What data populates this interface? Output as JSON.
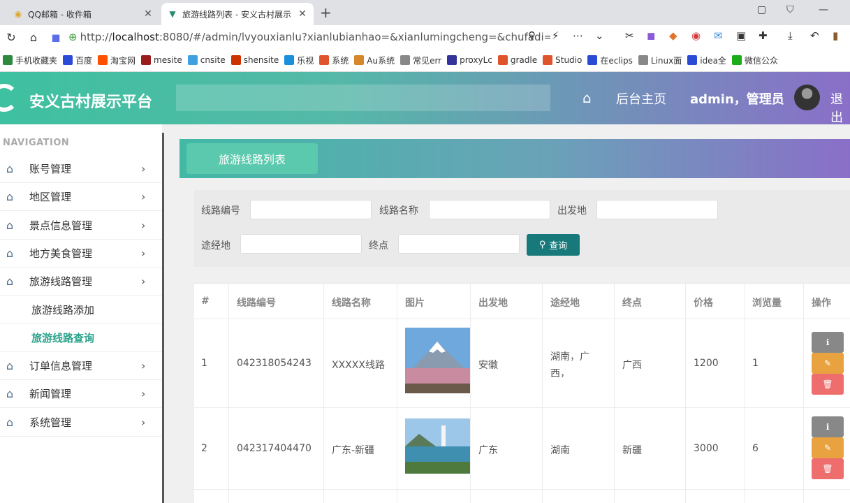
{
  "browser": {
    "tabs": [
      {
        "title": "QQ邮箱 - 收件箱",
        "active": false
      },
      {
        "title": "旅游线路列表 - 安义古村展示",
        "active": true
      }
    ],
    "url": {
      "prefix": "http://",
      "host": "localhost",
      "rest": ":8080/#/admin/lvyouxianlu?xianlubianhao=&xianlumingcheng=&chufadi=&"
    },
    "bookmarks": [
      {
        "label": "手机收藏夹",
        "color": "#2d8a3e"
      },
      {
        "label": "百度",
        "color": "#2b4bd6"
      },
      {
        "label": "淘宝网",
        "color": "#ff5000"
      },
      {
        "label": "mesite",
        "color": "#9b1c1c"
      },
      {
        "label": "cnsite",
        "color": "#3fa1e0"
      },
      {
        "label": "shensite",
        "color": "#cc3300"
      },
      {
        "label": "乐视",
        "color": "#1a8fdc"
      },
      {
        "label": "系统",
        "color": "#e0542c"
      },
      {
        "label": "Au系统",
        "color": "#d6862b"
      },
      {
        "label": "常见err",
        "color": "#888888"
      },
      {
        "label": "proxyLc",
        "color": "#333399"
      },
      {
        "label": "gradle",
        "color": "#e0542c"
      },
      {
        "label": "Studio",
        "color": "#e0542c"
      },
      {
        "label": "在eclips",
        "color": "#2b4bd6"
      },
      {
        "label": "Linux面",
        "color": "#888888"
      },
      {
        "label": "idea全",
        "color": "#2b4bd6"
      },
      {
        "label": "微信公众",
        "color": "#1aad19"
      }
    ]
  },
  "header": {
    "app_title": "安义古村展示平台",
    "home_label": "后台主页",
    "user_label": "admin，管理员",
    "logout_label": "退出"
  },
  "sidebar": {
    "heading": "NAVIGATION",
    "items": [
      {
        "label": "账号管理"
      },
      {
        "label": "地区管理"
      },
      {
        "label": "景点信息管理"
      },
      {
        "label": "地方美食管理"
      },
      {
        "label": "旅游线路管理"
      }
    ],
    "subitems": [
      {
        "label": "旅游线路添加"
      },
      {
        "label": "旅游线路查询"
      }
    ],
    "items_after": [
      {
        "label": "订单信息管理"
      },
      {
        "label": "新闻管理"
      },
      {
        "label": "系统管理"
      }
    ]
  },
  "page": {
    "title": "旅游线路列表"
  },
  "search": {
    "labels": {
      "route_no": "线路编号",
      "route_name": "线路名称",
      "origin": "出发地",
      "via": "途经地",
      "destination": "终点"
    },
    "values": {
      "route_no": "",
      "route_name": "",
      "origin": "",
      "via": "",
      "destination": ""
    },
    "button_label": "查询"
  },
  "table": {
    "headers": [
      "#",
      "线路编号",
      "线路名称",
      "图片",
      "出发地",
      "途经地",
      "终点",
      "价格",
      "浏览量",
      "操作"
    ],
    "rows": [
      {
        "idx": "1",
        "route_no": "042318054243",
        "route_name": "XXXXX线路",
        "origin": "安徽",
        "via_line1": "湖南，广",
        "via_line2": "西，",
        "destination": "广西",
        "price": "1200",
        "views": "1"
      },
      {
        "idx": "2",
        "route_no": "042317404470",
        "route_name": "广东-新疆",
        "origin": "广东",
        "via_line1": "湖南",
        "via_line2": "",
        "destination": "新疆",
        "price": "3000",
        "views": "6"
      }
    ]
  },
  "colors": {
    "accent": "#3ec1a0",
    "header_end": "#8a6fc8",
    "search_button": "#17797a",
    "active_menu": "#2aa38c",
    "info": "#888888",
    "edit": "#e8a23f",
    "delete": "#ee6d6d"
  }
}
